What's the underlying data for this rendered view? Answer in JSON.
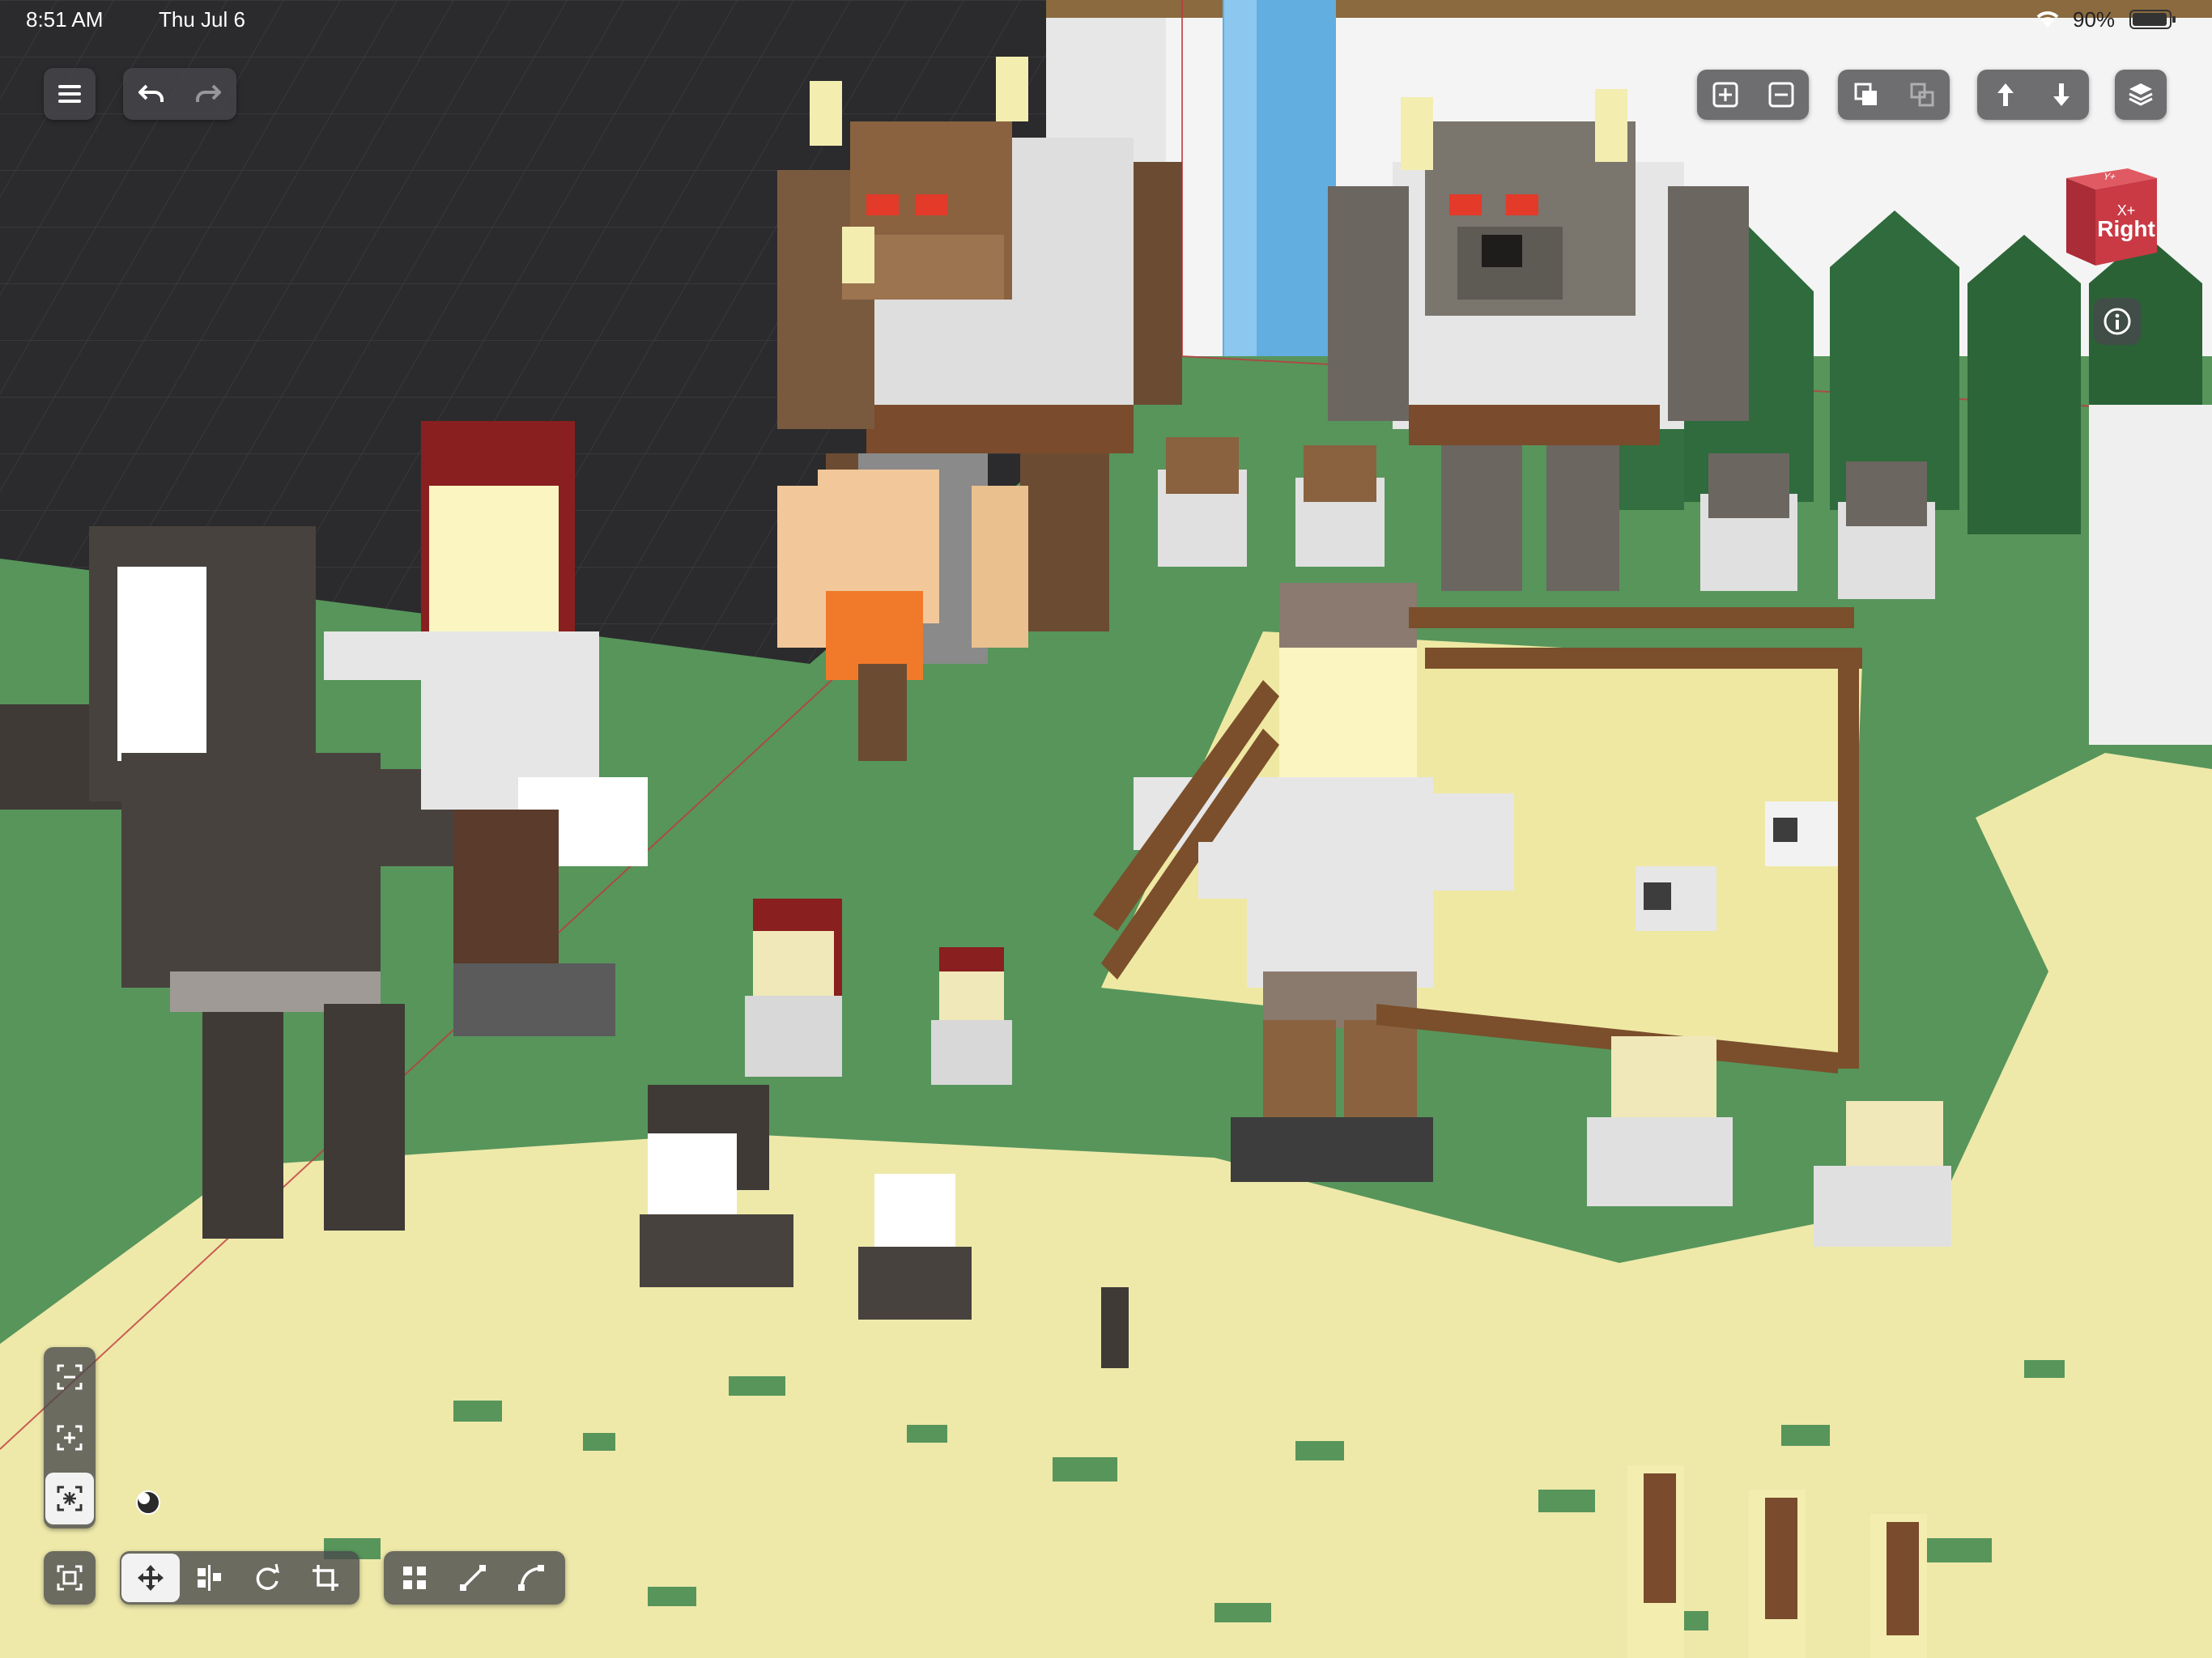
{
  "status_bar": {
    "time": "8:51 AM",
    "date": "Thu Jul 6",
    "battery_percent": "90%",
    "wifi_icon": "wifi-icon",
    "battery_icon": "battery-icon"
  },
  "view_cube": {
    "axis_label": "X+",
    "face_label": "Right",
    "top_hint": "Y+"
  },
  "toolbar_top_left": {
    "menu_icon": "hamburger-icon",
    "undo_icon": "undo-icon",
    "redo_icon": "redo-icon"
  },
  "toolbar_top_right": {
    "add_icon": "zoom-in-square-icon",
    "subtract_icon": "zoom-out-square-icon",
    "merge_icon": "merge-layers-icon",
    "split_icon": "split-layers-icon",
    "move_up_icon": "arrow-up-icon",
    "move_down_icon": "arrow-down-icon",
    "layers_icon": "layers-icon"
  },
  "toolbar_left_vertical": {
    "tools": [
      "select-frame-icon",
      "select-add-icon",
      "select-magic-icon"
    ]
  },
  "toolbar_bottom": {
    "focus_icon": "focus-frame-icon",
    "material_icon": "material-sphere-icon",
    "transform_tools": [
      "move-icon",
      "mirror-icon",
      "rotate-icon",
      "crop-icon"
    ],
    "extra_tools": [
      "grid-icon",
      "line-icon",
      "curve-icon"
    ],
    "active_tool": "move-icon"
  },
  "colors": {
    "grass": "#57955b",
    "sand": "#eee9a9",
    "dark_bg": "#2b2b2d",
    "toolbar": "#48484c",
    "cube_red": "#c93a45"
  }
}
